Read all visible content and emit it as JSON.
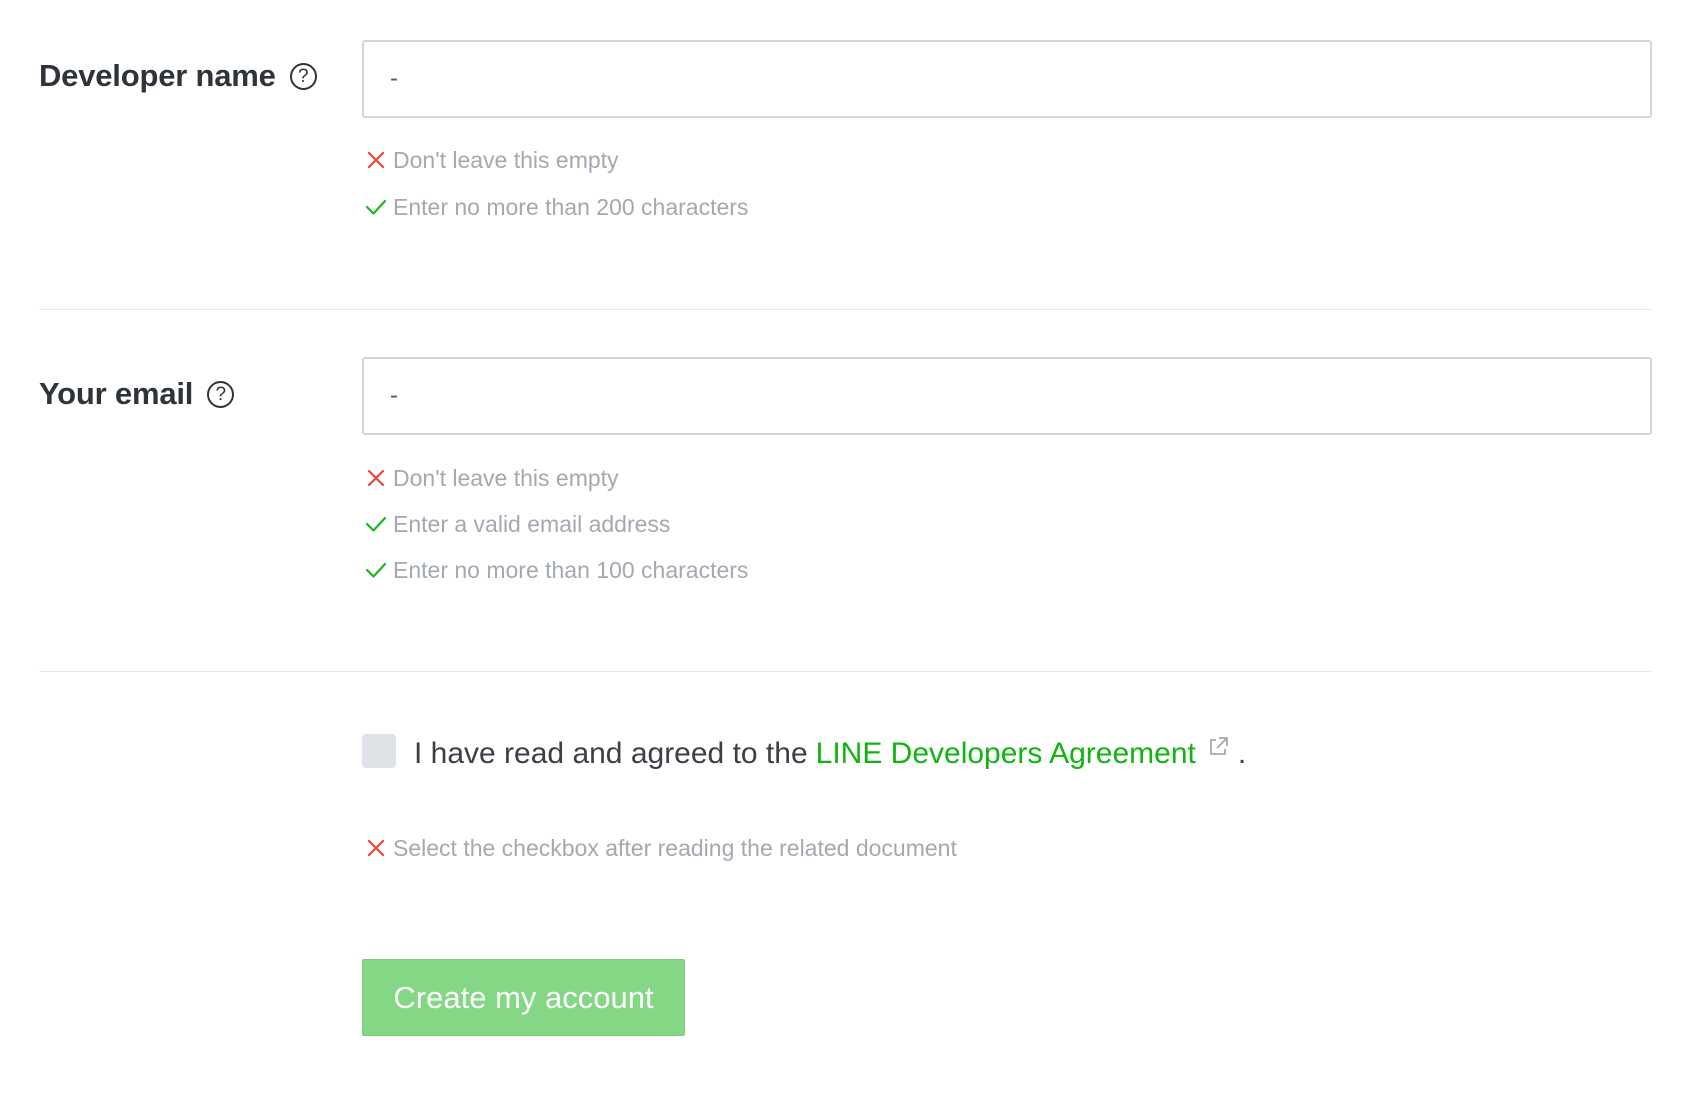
{
  "developer_name": {
    "label": "Developer name",
    "help_symbol": "?",
    "value": "-",
    "rules": [
      {
        "status": "error",
        "text": "Don't leave this empty"
      },
      {
        "status": "ok",
        "text": "Enter no more than 200 characters"
      }
    ]
  },
  "email": {
    "label": "Your email",
    "help_symbol": "?",
    "value": "-",
    "rules": [
      {
        "status": "error",
        "text": "Don't leave this empty"
      },
      {
        "status": "ok",
        "text": "Enter a valid email address"
      },
      {
        "status": "ok",
        "text": "Enter no more than 100 characters"
      }
    ]
  },
  "agreement": {
    "checked": false,
    "prefix": "I have read and agreed to the",
    "link_text": "LINE Developers Agreement",
    "suffix": ".",
    "rule": {
      "status": "error",
      "text": "Select the checkbox after reading the related document"
    }
  },
  "submit": {
    "label": "Create my account"
  },
  "colors": {
    "error": "#e5483d",
    "ok": "#1fb51f",
    "link": "#12b412",
    "button": "#84d784",
    "label": "#2f343a",
    "hint": "#a3a9b0"
  },
  "icons": {
    "help": "question-circle-icon",
    "error": "x-icon",
    "ok": "check-icon",
    "external": "external-link-icon"
  }
}
